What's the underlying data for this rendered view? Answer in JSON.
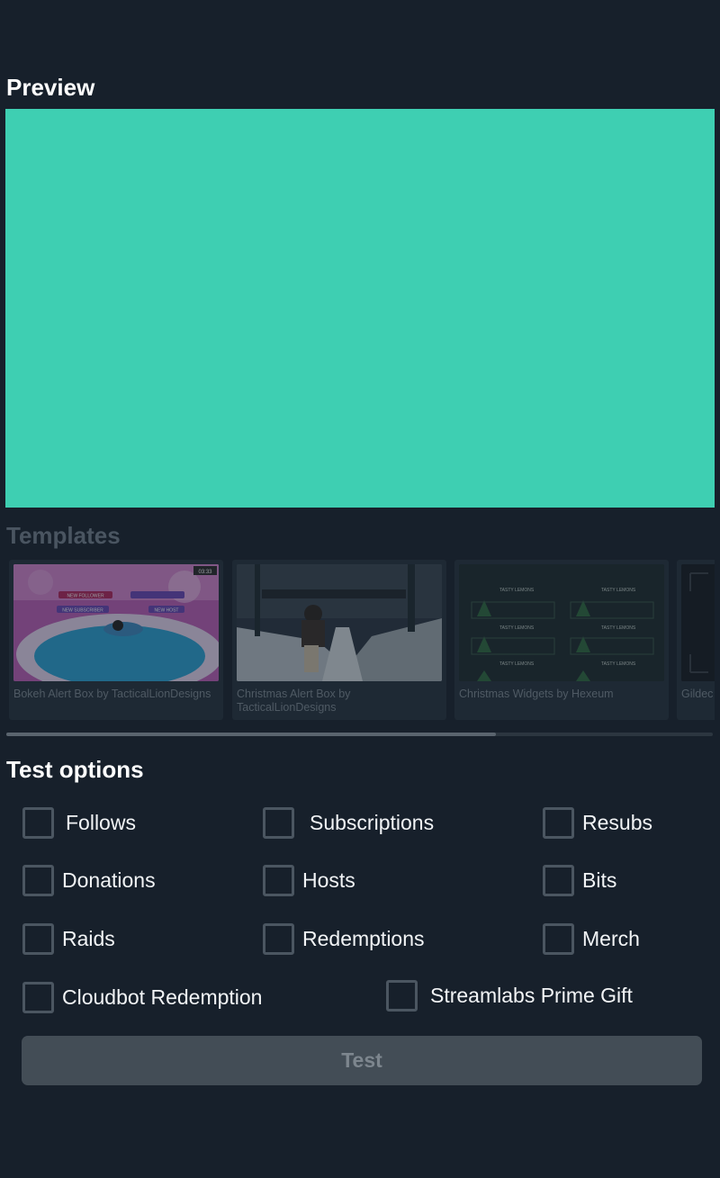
{
  "preview": {
    "title": "Preview",
    "color": "#3ecfb2"
  },
  "templates": {
    "title": "Templates",
    "items": [
      {
        "name": "Bokeh Alert Box by TacticalLionDesigns"
      },
      {
        "name": "Christmas Alert Box by TacticalLionDesigns"
      },
      {
        "name": "Christmas Widgets by Hexeum"
      },
      {
        "name": "Gildec"
      }
    ],
    "thumb_text": {
      "b1": "NEW FOLLOWER",
      "b2": "NEW SUBSCRIBER",
      "b3": "NEW HOST",
      "timer": "03:33",
      "tasty": "TASTY LEMONS"
    }
  },
  "test_options": {
    "title": "Test options",
    "options": [
      {
        "label": "Follows"
      },
      {
        "label": "Subscriptions"
      },
      {
        "label": "Resubs"
      },
      {
        "label": "Donations"
      },
      {
        "label": "Hosts"
      },
      {
        "label": "Bits"
      },
      {
        "label": "Raids"
      },
      {
        "label": "Redemptions"
      },
      {
        "label": "Merch"
      },
      {
        "label": "Cloudbot Redemption"
      },
      {
        "label": "Streamlabs Prime Gift"
      }
    ],
    "test_label": "Test"
  }
}
